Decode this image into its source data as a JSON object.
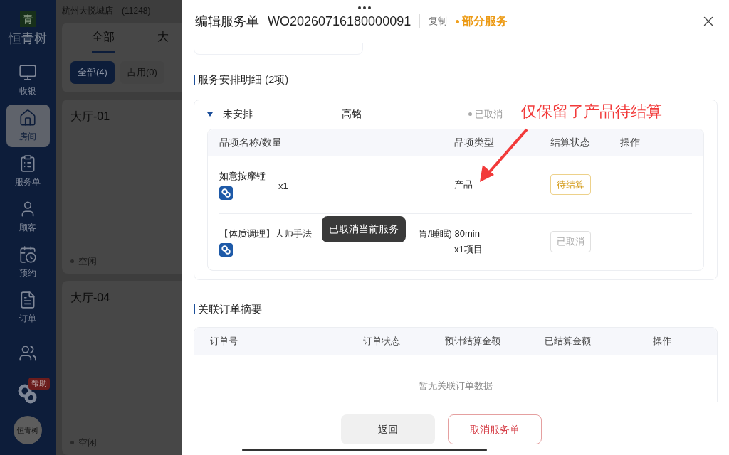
{
  "sidebar": {
    "logo_glyph": "青",
    "logo_text": "恒青树",
    "items": [
      {
        "label": "收银",
        "selected": false
      },
      {
        "label": "房间",
        "selected": true
      },
      {
        "label": "服务单",
        "selected": false
      },
      {
        "label": "顾客",
        "selected": false
      },
      {
        "label": "预约",
        "selected": false
      },
      {
        "label": "订单",
        "selected": false
      },
      {
        "selected": false
      }
    ],
    "help_badge": "帮助",
    "avatar_text": "恒青树"
  },
  "background": {
    "store": "杭州大悦城店",
    "store_code": "(11248)",
    "tabs": [
      {
        "label": "全部",
        "selected": true
      },
      {
        "label": "大",
        "selected": false
      }
    ],
    "filters": [
      {
        "label": "全部(4)",
        "selected": true
      },
      {
        "label": "占用(0)",
        "selected": false
      }
    ],
    "rooms": [
      {
        "name": "大厅-01",
        "status": "空闲"
      },
      {
        "name": "大厅-04",
        "status": "空闲"
      }
    ]
  },
  "drawer": {
    "title": "编辑服务单",
    "order_no": "WO20260716180000091",
    "copy": "复制",
    "status": "部分服务",
    "section1": {
      "title": "服务安排明细",
      "count": "(2项)"
    },
    "group": {
      "label": "未安排",
      "staff": "高铭",
      "state": "已取消",
      "expanded": true
    },
    "columns": [
      "品项名称/数量",
      "品项类型",
      "结算状态",
      "操作"
    ],
    "items": [
      {
        "name": "如意按摩锤",
        "qty": "x1",
        "type": "产品",
        "settle": "待结算",
        "kind": "pending"
      },
      {
        "name": "【体质调理】大师手法",
        "name_tail": "胃/睡眠) 80min",
        "qty": "x1项目",
        "settle": "已取消",
        "kind": "cancelled"
      }
    ],
    "toast": "已取消当前服务",
    "annotation": "仅保留了产品待结算",
    "section2": {
      "title": "关联订单摘要",
      "columns": [
        "订单号",
        "订单状态",
        "预计结算金额",
        "已结算金额",
        "操作"
      ],
      "empty": "暂无关联订单数据"
    },
    "buttons": [
      {
        "label": "返回",
        "kind": "secondary"
      },
      {
        "label": "取消服务单",
        "kind": "danger"
      }
    ]
  }
}
